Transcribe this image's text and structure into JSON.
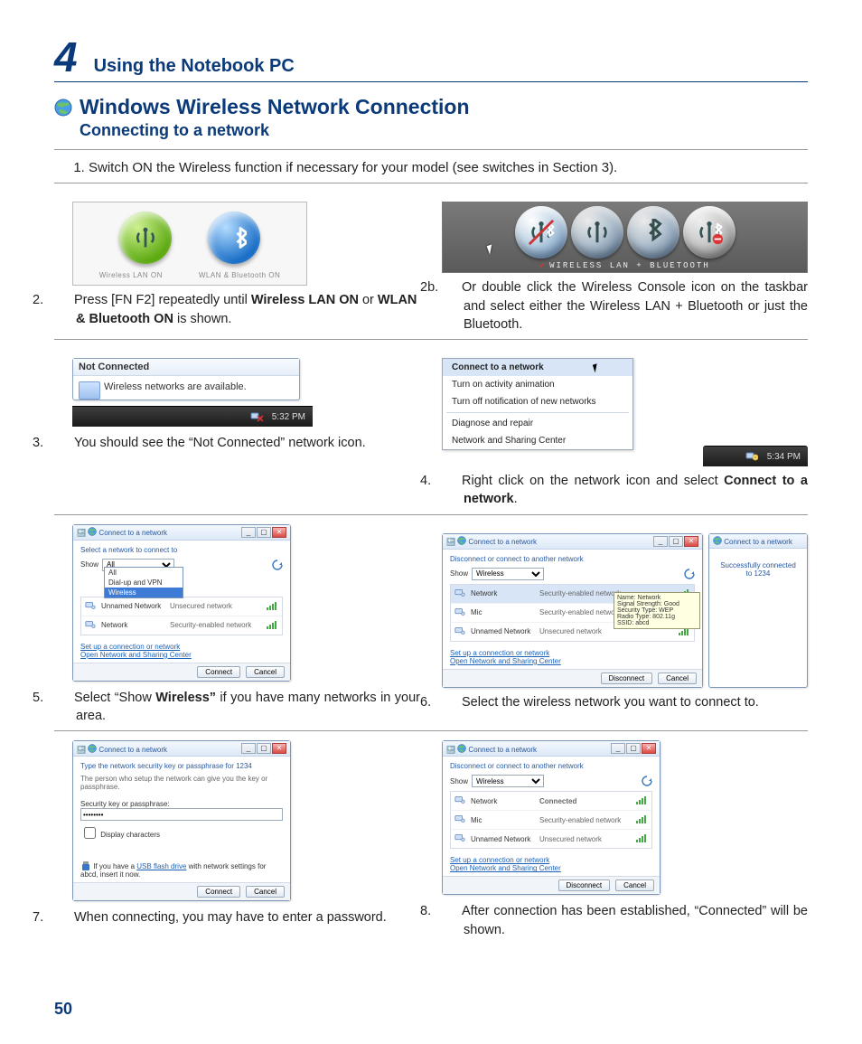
{
  "chapter": {
    "num": "4",
    "title": "Using the Notebook PC"
  },
  "section": {
    "title": "Windows Wireless Network Connection",
    "sub": "Connecting to a network"
  },
  "page_num": "50",
  "s1": "Switch ON the Wireless function if necessary for your model (see switches in Section 3).",
  "orbs": {
    "wlan": "Wireless LAN ON",
    "bt": "WLAN & Bluetooth ON"
  },
  "s2_pre": "Press [FN F2] repeatedly until ",
  "s2_b1": "Wireless LAN ON",
  "s2_mid": " or ",
  "s2_b2": "WLAN & Bluetooth ON",
  "s2_post": " is shown.",
  "console_caption": "WIRELESS LAN + BLUETOOTH",
  "s2b": "Or double click the Wireless Console icon on the taskbar and select either the Wireless LAN + Bluetooth or just the Bluetooth.",
  "tray": {
    "title": "Not Connected",
    "body": "Wireless networks are available.",
    "clock": "5:32 PM"
  },
  "s3": "You should see the “Not Connected” network icon.",
  "ctx": {
    "connect": "Connect to a network",
    "anim": "Turn on activity animation",
    "notif": "Turn off notification of new networks",
    "diag": "Diagnose and repair",
    "center": "Network and Sharing Center",
    "clock": "5:34 PM"
  },
  "s4_pre": "Right click on the network icon and select ",
  "s4_b": "Connect to a network",
  "s4_post": ".",
  "dlg": {
    "title": "Connect to a network",
    "select_hdr": "Select a network to connect to",
    "disconnect_hdr": "Disconnect or connect to another network",
    "show": "Show",
    "filters": {
      "all": "All",
      "dial": "Dial-up and VPN",
      "wireless": "Wireless"
    },
    "link1": "Set up a connection or network",
    "link2": "Open Network and Sharing Center",
    "btn_connect": "Connect",
    "btn_disconnect": "Disconnect",
    "btn_cancel": "Cancel",
    "nets": {
      "unnamed": "Unnamed Network",
      "network": "Network",
      "mic": "Mic",
      "sec": "Security-enabled network",
      "unsec": "Unsecured network",
      "connected": "Connected"
    },
    "tooltip": [
      "Name: Network",
      "Signal Strength: Good",
      "Security Type: WEP",
      "Radio Type: 802.11g",
      "SSID: abcd"
    ],
    "success": "Successfully connected to 1234"
  },
  "s5_pre": "Select “Show ",
  "s5_b": "Wireless”",
  "s5_post": " if you have many networks in your area.",
  "s6": "Select the wireless network you want to connect to.",
  "pass": {
    "hdr": "Type the network security key or passphrase for 1234",
    "sub": "The person who setup the network can give you the key or passphrase.",
    "lbl": "Security key or passphrase:",
    "val": "••••••••",
    "chk": "Display characters",
    "usb_pre": "If you have a ",
    "usb_link": "USB flash drive",
    "usb_post": " with network settings for abcd, insert it now."
  },
  "s7": "When connecting, you may have to enter a password.",
  "s8": "After connection has been established, “Connected” will be shown."
}
